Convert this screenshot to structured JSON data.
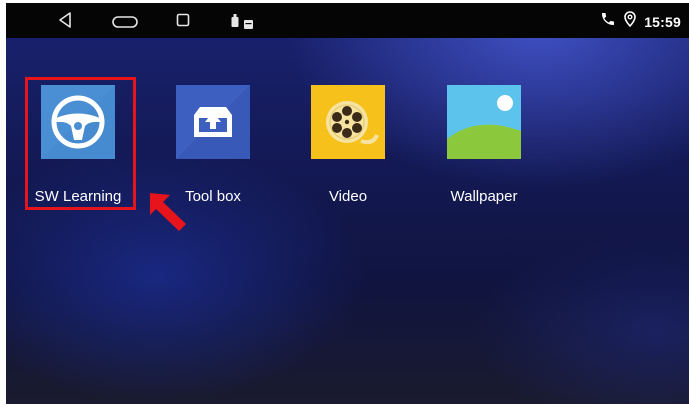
{
  "status_bar": {
    "time": "15:59",
    "nav_icons": [
      "back-icon",
      "home-icon",
      "recent-apps-icon"
    ],
    "notification_icons": [
      "usb-icon",
      "media-icon"
    ],
    "right_icons": [
      "phone-icon",
      "location-icon"
    ]
  },
  "apps": [
    {
      "label": "SW Learning",
      "icon": "steering-wheel-icon",
      "highlighted": true
    },
    {
      "label": "Tool box",
      "icon": "toolbox-upload-icon"
    },
    {
      "label": "Video",
      "icon": "film-reel-icon"
    },
    {
      "label": "Wallpaper",
      "icon": "wallpaper-icon"
    }
  ],
  "colors": {
    "highlight": "#e8141c",
    "sw_tile": "#4a8fd4",
    "toolbox_tile": "#3d5fc0",
    "video_tile": "#f5c11a",
    "wallpaper_sky": "#5cc4ec",
    "wallpaper_hill": "#8cc83c"
  }
}
